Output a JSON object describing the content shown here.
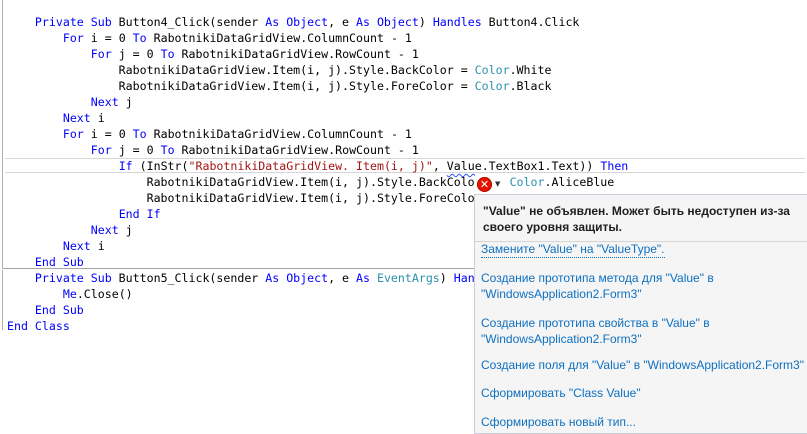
{
  "code_lines": [
    [
      {
        "t": "    "
      },
      {
        "t": "Private Sub",
        "c": "kw"
      },
      {
        "t": " Button4_Click(sender "
      },
      {
        "t": "As Object",
        "c": "kw"
      },
      {
        "t": ", e "
      },
      {
        "t": "As Object",
        "c": "kw"
      },
      {
        "t": ") "
      },
      {
        "t": "Handles",
        "c": "kw"
      },
      {
        "t": " Button4.Click"
      }
    ],
    [
      {
        "t": "        "
      },
      {
        "t": "For",
        "c": "kw"
      },
      {
        "t": " i = 0 "
      },
      {
        "t": "To",
        "c": "kw"
      },
      {
        "t": " RabotnikiDataGridView.ColumnCount - 1"
      }
    ],
    [
      {
        "t": "            "
      },
      {
        "t": "For",
        "c": "kw"
      },
      {
        "t": " j = 0 "
      },
      {
        "t": "To",
        "c": "kw"
      },
      {
        "t": " RabotnikiDataGridView.RowCount - 1"
      }
    ],
    [
      {
        "t": "                RabotnikiDataGridView.Item(i, j).Style.BackColor = "
      },
      {
        "t": "Color",
        "c": "ty"
      },
      {
        "t": ".White"
      }
    ],
    [
      {
        "t": "                RabotnikiDataGridView.Item(i, j).Style.ForeColor = "
      },
      {
        "t": "Color",
        "c": "ty"
      },
      {
        "t": ".Black"
      }
    ],
    [
      {
        "t": "            "
      },
      {
        "t": "Next",
        "c": "kw"
      },
      {
        "t": " j"
      }
    ],
    [
      {
        "t": "        "
      },
      {
        "t": "Next",
        "c": "kw"
      },
      {
        "t": " i"
      }
    ],
    [
      {
        "t": "        "
      },
      {
        "t": "For",
        "c": "kw"
      },
      {
        "t": " i = 0 "
      },
      {
        "t": "To",
        "c": "kw"
      },
      {
        "t": " RabotnikiDataGridView.ColumnCount - 1"
      }
    ],
    [
      {
        "t": "            "
      },
      {
        "t": "For",
        "c": "kw"
      },
      {
        "t": " j = 0 "
      },
      {
        "t": "To",
        "c": "kw"
      },
      {
        "t": " RabotnikiDataGridView.RowCount - 1"
      }
    ],
    [
      {
        "t": "                "
      },
      {
        "t": "If",
        "c": "kw"
      },
      {
        "t": " (InStr("
      },
      {
        "t": "\"RabotnikiDataGridView. Item(i, j)\"",
        "c": "str"
      },
      {
        "t": ", "
      },
      {
        "t": "Value",
        "c": "err"
      },
      {
        "t": ".TextBox1.Text)) "
      },
      {
        "t": "Then",
        "c": "kw"
      }
    ],
    [
      {
        "t": "                    RabotnikiDataGridView.Item(i, j).Style.BackColo     "
      },
      {
        "t": "Color",
        "c": "ty"
      },
      {
        "t": ".AliceBlue"
      }
    ],
    [
      {
        "t": "                    RabotnikiDataGridView.Item(i, j).Style.ForeColo"
      }
    ],
    [
      {
        "t": "                "
      },
      {
        "t": "End If",
        "c": "kw"
      }
    ],
    [
      {
        "t": "            "
      },
      {
        "t": "Next",
        "c": "kw"
      },
      {
        "t": " j"
      }
    ],
    [
      {
        "t": "        "
      },
      {
        "t": "Next",
        "c": "kw"
      },
      {
        "t": " i"
      }
    ],
    [
      {
        "t": "    "
      },
      {
        "t": "End Sub",
        "c": "kw"
      }
    ],
    [
      {
        "t": "    "
      },
      {
        "t": "Private Sub",
        "c": "kw"
      },
      {
        "t": " Button5_Click(sender "
      },
      {
        "t": "As Object",
        "c": "kw"
      },
      {
        "t": ", e "
      },
      {
        "t": "As",
        "c": "kw"
      },
      {
        "t": " "
      },
      {
        "t": "EventArgs",
        "c": "ty"
      },
      {
        "t": ") "
      },
      {
        "t": "Hand",
        "c": "kw"
      }
    ],
    [
      {
        "t": "        "
      },
      {
        "t": "Me",
        "c": "kw"
      },
      {
        "t": ".Close()"
      }
    ],
    [
      {
        "t": "    "
      },
      {
        "t": "End Sub",
        "c": "kw"
      }
    ],
    [
      {
        "t": "End Class",
        "c": "kw"
      }
    ]
  ],
  "smart_tag": {
    "icon": "error-icon",
    "glyph": "✕",
    "arrow": "▼"
  },
  "popup": {
    "header": "\"Value\" не объявлен. Может быть недоступен из-за своего уровня защиты.",
    "items": [
      "Замените \"Value\" на \"ValueType\".",
      "Создание прототипа метода для \"Value\" в \"WindowsApplication2.Form3\"",
      "Создание прототипа свойства в \"Value\" в \"WindowsApplication2.Form3\"",
      "Создание поля для \"Value\" в \"WindowsApplication2.Form3\"",
      "Сформировать \"Class Value\"",
      "Сформировать новый тип..."
    ]
  },
  "colors": {
    "keyword": "#0000ff",
    "type": "#2b91af",
    "string": "#a31515",
    "link": "#0e70c0",
    "error": "#e51400"
  }
}
